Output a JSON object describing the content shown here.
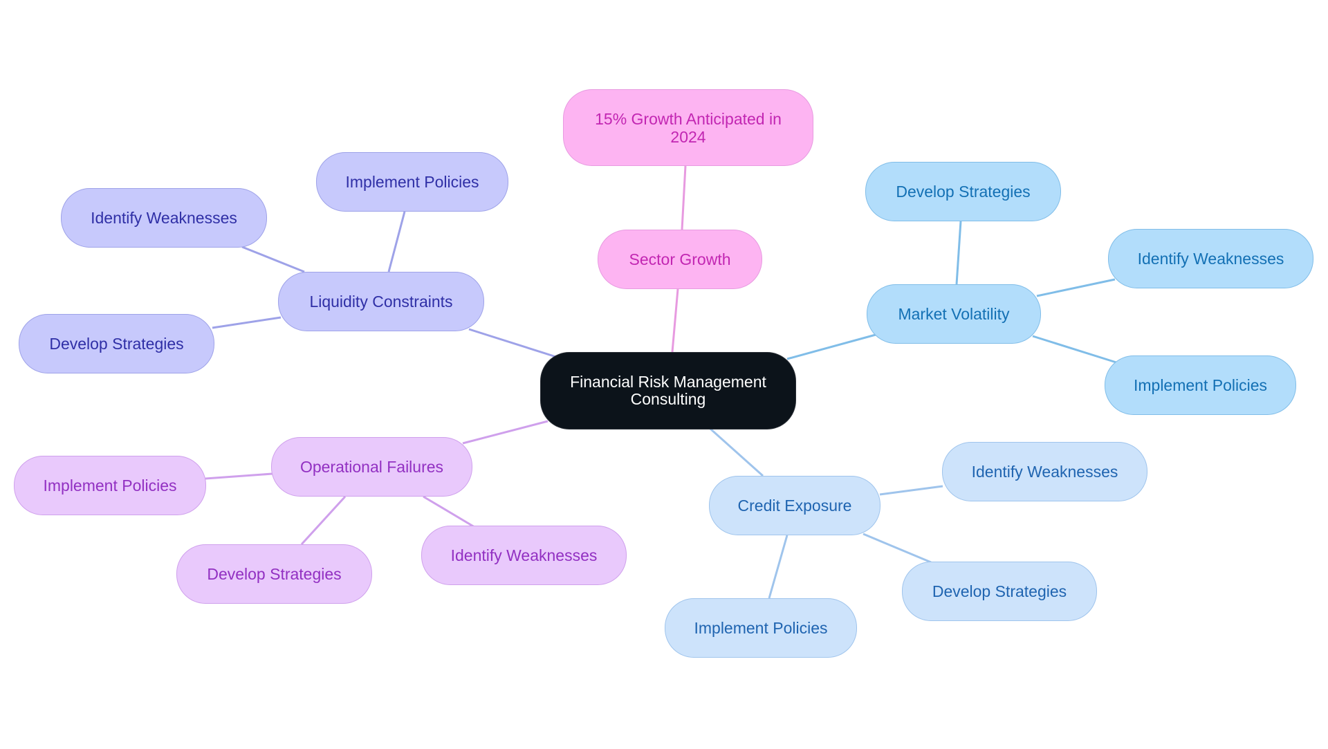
{
  "diagram": {
    "type": "mindmap",
    "root": {
      "label": "Financial Risk Management Consulting"
    },
    "branches": [
      {
        "label": "Sector Growth",
        "color": "#fdb4f2",
        "text_color": "#c226b2",
        "children": [
          "15% Growth Anticipated in 2024"
        ]
      },
      {
        "label": "Market Volatility",
        "color": "#b2ddfb",
        "text_color": "#1370b4",
        "children": [
          "Develop Strategies",
          "Identify Weaknesses",
          "Implement Policies"
        ]
      },
      {
        "label": "Credit Exposure",
        "color": "#cde3fb",
        "text_color": "#1f64b0",
        "children": [
          "Identify Weaknesses",
          "Develop Strategies",
          "Implement Policies"
        ]
      },
      {
        "label": "Operational Failures",
        "color": "#e9c9fc",
        "text_color": "#9230c2",
        "children": [
          "Implement Policies",
          "Develop Strategies",
          "Identify Weaknesses"
        ]
      },
      {
        "label": "Liquidity Constraints",
        "color": "#c7c9fc",
        "text_color": "#2f2fa6",
        "children": [
          "Implement Policies",
          "Identify Weaknesses",
          "Develop Strategies"
        ]
      }
    ]
  }
}
